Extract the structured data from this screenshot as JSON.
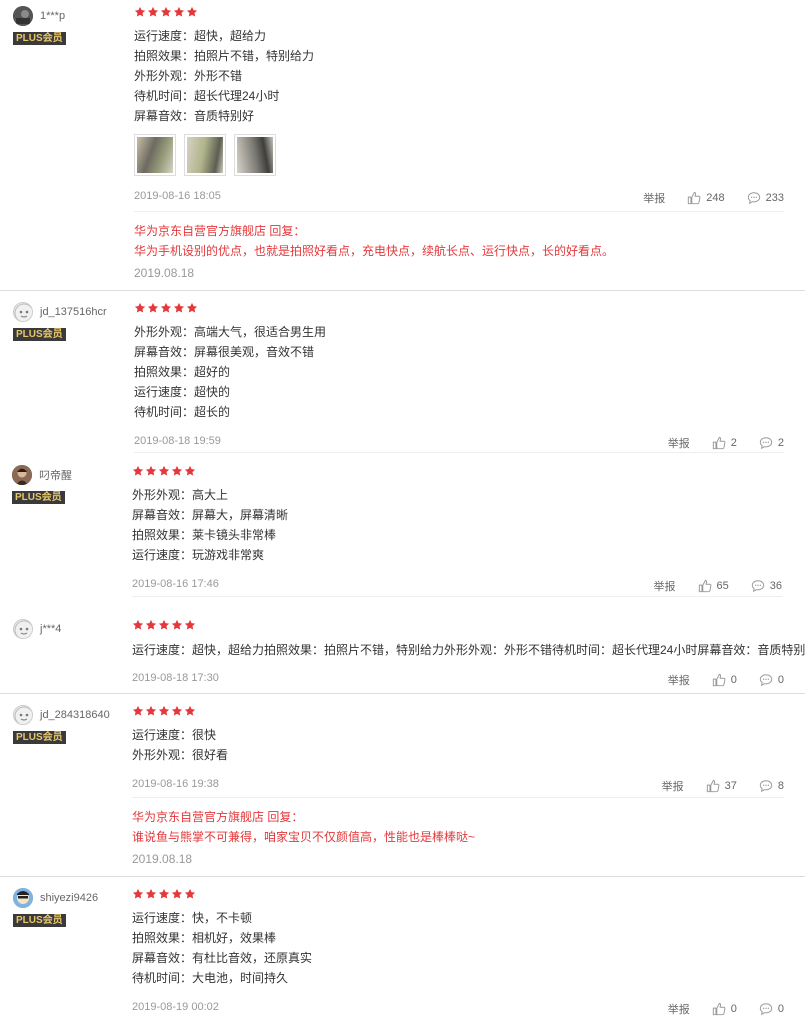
{
  "labels": {
    "plus": "PLUS会员",
    "report": "举报",
    "star_icon": "star-icon",
    "like_icon": "thumbs-up-icon",
    "comment_icon": "comment-icon"
  },
  "colors": {
    "star": "#e4393c",
    "reply": "#e4393c",
    "plus_bg": "#3a3a3a",
    "plus_text": "#e8c66a"
  },
  "reviews": [
    {
      "user": "1***p",
      "plus": true,
      "stars": 5,
      "lines": [
        "运行速度：超快，超给力",
        "拍照效果：拍照片不错，特别给力",
        "外形外观：外形不错",
        "待机时间：超长代理24小时",
        "屏幕音效：音质特别好"
      ],
      "images": 3,
      "date": "2019-08-16 18:05",
      "likes": "248",
      "comments": "233",
      "reply": {
        "head": "华为京东自营官方旗舰店 回复：",
        "text": "华为手机设别的优点，也就是拍照好看点，充电快点，续航长点、运行快点，长的好看点。",
        "date": "2019.08.18"
      }
    },
    {
      "user": "jd_137516hcr",
      "plus": true,
      "stars": 5,
      "lines": [
        "外形外观：高端大气，很适合男生用",
        "屏幕音效：屏幕很美观，音效不错",
        "拍照效果：超好的",
        "运行速度：超快的",
        "待机时间：超长的"
      ],
      "date": "2019-08-18 19:59",
      "likes": "2",
      "comments": "2"
    },
    {
      "user": "叼帝醒",
      "plus": true,
      "stars": 5,
      "lines": [
        "外形外观：高大上",
        "屏幕音效：屏幕大，屏幕清晰",
        "拍照效果：莱卡镜头非常棒",
        "运行速度：玩游戏非常爽"
      ],
      "date": "2019-08-16 17:46",
      "likes": "65",
      "comments": "36"
    },
    {
      "user": "j***4",
      "plus": false,
      "stars": 5,
      "lines": [
        "运行速度：超快，超给力拍照效果：拍照片不错，特别给力外形外观：外形不错待机时间：超长代理24小时屏幕音效：音质特别好"
      ],
      "date": "2019-08-18 17:30",
      "likes": "0",
      "comments": "0"
    },
    {
      "user": "jd_284318640",
      "plus": true,
      "stars": 5,
      "lines": [
        "运行速度：很快",
        "外形外观：很好看"
      ],
      "date": "2019-08-16 19:38",
      "likes": "37",
      "comments": "8",
      "reply": {
        "head": "华为京东自营官方旗舰店 回复：",
        "text": "谁说鱼与熊掌不可兼得，咱家宝贝不仅颜值高，性能也是棒棒哒~",
        "date": "2019.08.18"
      }
    },
    {
      "user": "shiyezi9426",
      "plus": true,
      "stars": 5,
      "lines": [
        "运行速度：快，不卡顿",
        "拍照效果：相机好，效果棒",
        "屏幕音效：有杜比音效，还原真实",
        "待机时间：大电池，时间持久"
      ],
      "date": "2019-08-19 00:02",
      "likes": "0",
      "comments": "0"
    }
  ]
}
